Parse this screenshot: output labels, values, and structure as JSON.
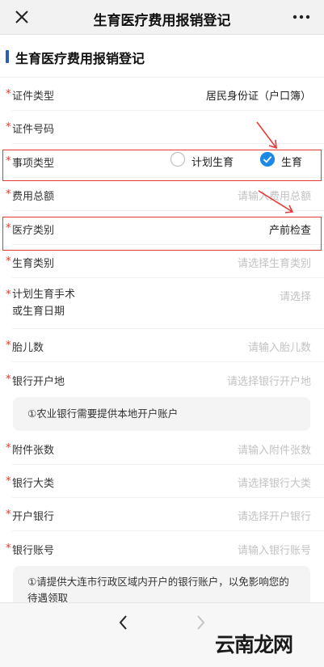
{
  "header": {
    "title": "生育医疗费用报销登记",
    "close_icon": "close-icon",
    "more_icon": "more-icon"
  },
  "page": {
    "heading": "生育医疗费用报销登记"
  },
  "form": {
    "required_mark": "*",
    "id_type": {
      "label": "证件类型",
      "value": "居民身份证（户口簿）"
    },
    "id_number": {
      "label": "证件号码",
      "value": ""
    },
    "matter_type": {
      "label": "事项类型",
      "options": [
        "计划生育",
        "生育"
      ],
      "selected": "生育"
    },
    "total_cost": {
      "label": "费用总额",
      "placeholder": "请输入费用总额"
    },
    "medical_category": {
      "label": "医疗类别",
      "value": "产前检查"
    },
    "birth_category": {
      "label": "生育类别",
      "placeholder": "请选择生育类别"
    },
    "surgery_date": {
      "label_line1": "计划生育手术",
      "label_line2": "或生育日期",
      "placeholder": "请选择"
    },
    "fetus_count": {
      "label": "胎儿数",
      "placeholder": "请输入胎儿数"
    },
    "bank_location": {
      "label": "银行开户地",
      "placeholder": "请选择银行开户地"
    },
    "note1": "①农业银行需要提供本地开户账户",
    "attachment_count": {
      "label": "附件张数",
      "placeholder": "请输入附件张数"
    },
    "bank_major": {
      "label": "银行大类",
      "placeholder": "请选择银行大类"
    },
    "opening_bank": {
      "label": "开户银行",
      "placeholder": "请选择开户银行"
    },
    "bank_account": {
      "label": "银行账号",
      "placeholder": "请输入银行账号"
    },
    "note2": "①请提供大连市行政区域内开户的银行账户，以免影响您的待遇领取"
  },
  "annotations": {
    "highlight_color": "#e53935"
  },
  "bottom_nav": {
    "back_icon": "back-arrow-icon",
    "forward_icon": "forward-arrow-icon"
  },
  "watermark": {
    "text": "云南龙网"
  },
  "colors": {
    "accent": "#1e88e5",
    "heading_bar": "#2b5fb3",
    "required": "#e03a2f"
  }
}
